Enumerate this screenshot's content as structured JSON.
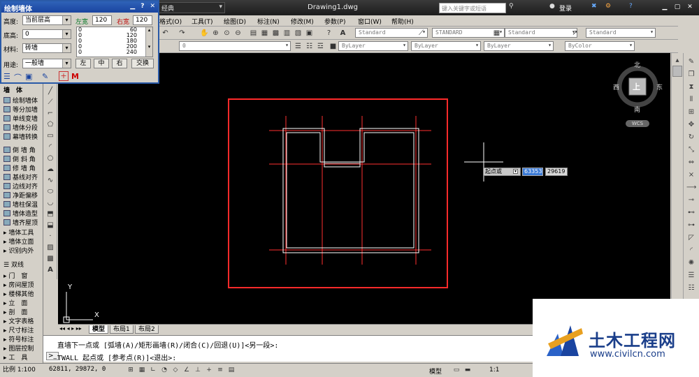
{
  "window": {
    "document_title": "Drawing1.dwg",
    "workspace": "经典",
    "help_search_placeholder": "键入关键字或短语",
    "login_label": "登录"
  },
  "menu": {
    "items": [
      "格式(O)",
      "工具(T)",
      "绘图(D)",
      "标注(N)",
      "修改(M)",
      "参数(P)",
      "窗口(W)",
      "帮助(H)"
    ]
  },
  "toolbar": {
    "text_style": "Standard",
    "dim_style": "STANDARD",
    "table_style": "Standard",
    "multileader_style": "Standard",
    "layer_value": "0",
    "color": "ByLayer",
    "linetype": "ByLayer",
    "lineweight": "ByLayer",
    "plotstyle": "ByColor"
  },
  "wall_panel": {
    "title": "绘制墙体",
    "height_label": "高度:",
    "height_value": "当前层高",
    "base_label": "底高:",
    "base_value": "0",
    "material_label": "材料:",
    "material_value": "砖墙",
    "usage_label": "用途:",
    "usage_value": "一般墙",
    "left_width_label": "左宽",
    "left_width_value": "120",
    "right_width_label": "右宽",
    "right_width_value": "120",
    "width_list": [
      {
        "left": "0",
        "right": "60"
      },
      {
        "left": "0",
        "right": "120"
      },
      {
        "left": "0",
        "right": "180"
      },
      {
        "left": "0",
        "right": "200"
      },
      {
        "left": "0",
        "right": "240"
      }
    ],
    "buttons": {
      "left": "左",
      "center": "中",
      "right": "右",
      "swap": "交换"
    },
    "m_label": "M"
  },
  "left_tools": {
    "group_title": "墙　体",
    "items": [
      "绘制墙体",
      "等分加墙",
      "单线变墙",
      "墙体分段",
      "幕墙转换",
      "倒 墙 角",
      "倒 斜 角",
      "修 墙 角",
      "基线对齐",
      "边线对齐",
      "净距偏移",
      "墙柱保温",
      "墙体造型",
      "墙齐屋顶",
      "墙体工具",
      "墙体立面",
      "识别内外"
    ],
    "section2_title": "双线",
    "section2_items": [
      "门　窗",
      "房间屋顶",
      "楼梯其他",
      "立　面",
      "剖　面",
      "文字表格",
      "尺寸标注",
      "符号标注",
      "图层控制",
      "工　具"
    ]
  },
  "viewcube": {
    "north": "北",
    "south": "南",
    "east": "东",
    "west": "西",
    "face": "上",
    "wcs": "WCS"
  },
  "dynamic_input": {
    "label": "起点或",
    "x_value": "63353",
    "y_value": "29619"
  },
  "tabs": [
    "模型",
    "布局1",
    "布局2"
  ],
  "command": {
    "line1": "直墙下一点或 [弧墙(A)/矩形画墙(R)/闭合(C)/回退(U)]<另一段>:",
    "line2": "TWALL 起点或 [参考点(R)]<退出>:"
  },
  "status": {
    "scale": "比例 1:100",
    "coords": "62811, 29872, 0",
    "model_label": "模型",
    "anno_scale": "1:1"
  },
  "watermark": {
    "text": "土木工程网",
    "url": "www.civilcn.com"
  },
  "colors": {
    "canvas_bg": "#000000",
    "wall_line": "#ffffff",
    "axis_line": "#ff3030",
    "frame_line": "#ff2a2a",
    "panel_title": "#1a44a0"
  }
}
